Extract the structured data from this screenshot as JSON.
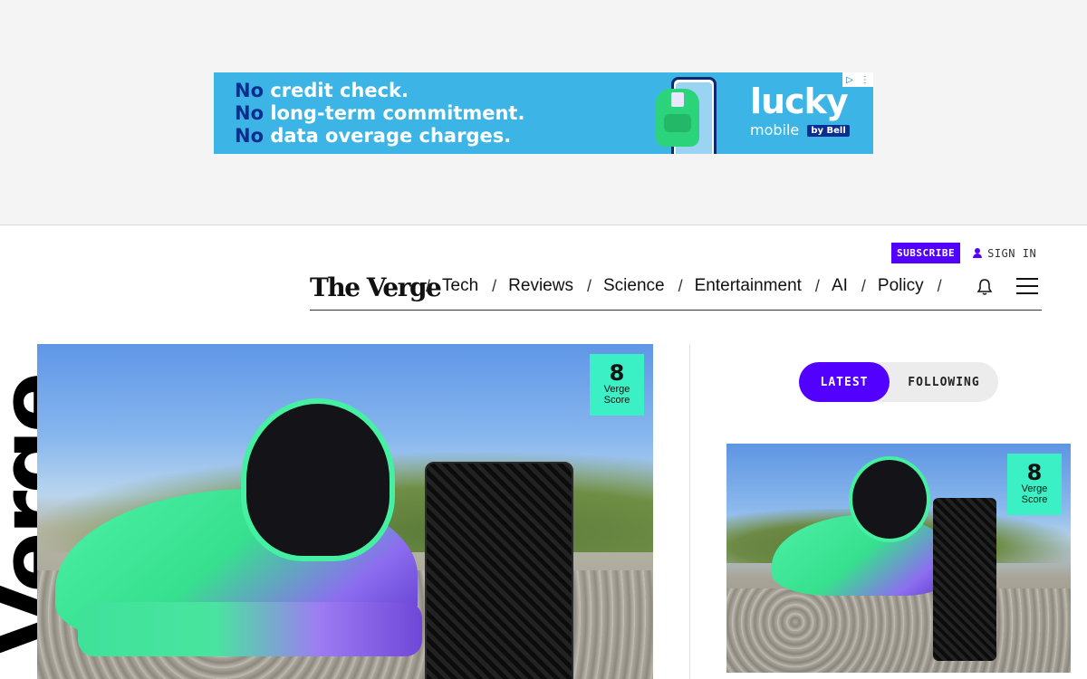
{
  "ad": {
    "line_prefix": "No",
    "lines": [
      "credit check.",
      "long-term commitment.",
      "data overage charges."
    ],
    "brand": "lucky",
    "brand_sub": "mobile",
    "brand_by": "by",
    "brand_bell": "Bell",
    "background_color": "#3cb4e5",
    "accent_color": "#0a2d8f"
  },
  "header": {
    "subscribe_label": "SUBSCRIBE",
    "signin_label": "SIGN IN",
    "logo_text": "The Verge",
    "accent_color": "#5200ff"
  },
  "nav": {
    "separator": "/",
    "items": [
      "Tech",
      "Reviews",
      "Science",
      "Entertainment",
      "AI",
      "Policy"
    ]
  },
  "vertical_logo": "Verge",
  "hero": {
    "score_value": "8",
    "score_label_1": "Verge",
    "score_label_2": "Score"
  },
  "feed_toggle": {
    "latest_label": "LATEST",
    "following_label": "FOLLOWING"
  },
  "side_story": {
    "score_value": "8",
    "score_label_1": "Verge",
    "score_label_2": "Score",
    "score_color": "#3cf0c5"
  }
}
